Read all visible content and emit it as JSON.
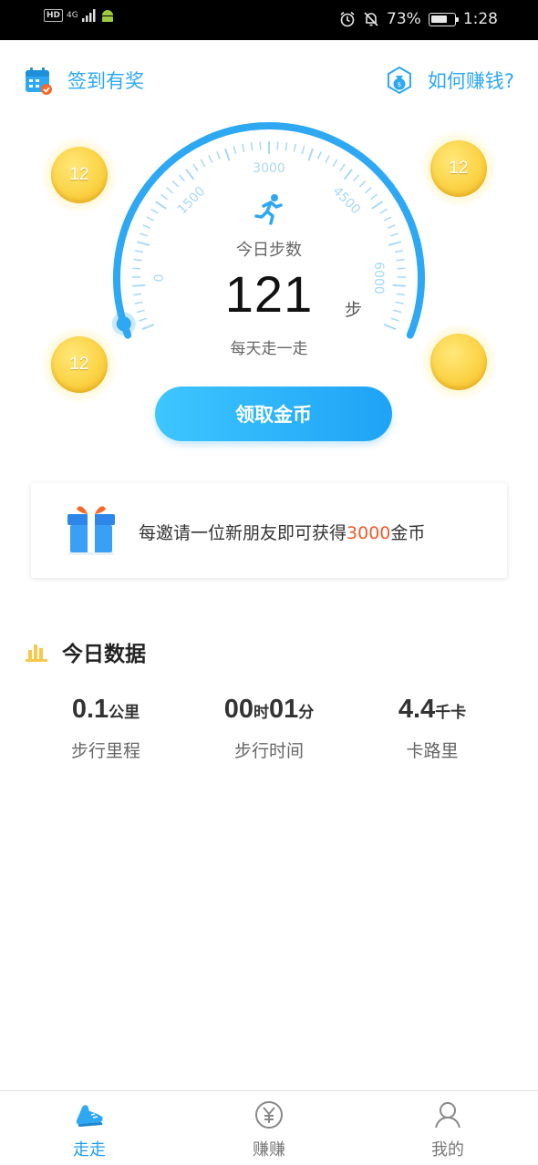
{
  "status_bar": {
    "hd": "HD",
    "network": "4G",
    "battery_percent": "73%",
    "battery_level": 0.73,
    "time": "1:28",
    "icons": [
      "alarm-icon",
      "mute-icon",
      "battery-icon"
    ]
  },
  "header": {
    "signin_label": "签到有奖",
    "how_to_earn_label": "如何赚钱?"
  },
  "gauge": {
    "ticks": [
      "0",
      "1500",
      "3000",
      "4500",
      "6000"
    ],
    "today_steps_label": "今日步数",
    "step_count": "121",
    "step_unit": "步",
    "slogan": "每天走一走",
    "progress": 0.02
  },
  "coins": [
    "12",
    "12",
    "12",
    ""
  ],
  "claim_button": "领取金币",
  "invite": {
    "text_prefix": "每邀请一位新朋友即可获得",
    "amount": "3000",
    "text_suffix": "金币"
  },
  "today_data": {
    "title": "今日数据",
    "stats": [
      {
        "value_parts": [
          "0.1",
          "公里"
        ],
        "label": "步行里程"
      },
      {
        "value_parts": [
          "00",
          "时",
          "01",
          "分"
        ],
        "label": "步行时间"
      },
      {
        "value_parts": [
          "4.4",
          "千卡"
        ],
        "label": "卡路里"
      }
    ]
  },
  "bottom_nav": {
    "items": [
      {
        "label": "走走",
        "icon": "shoe-icon",
        "active": true
      },
      {
        "label": "赚赚",
        "icon": "yuan-icon",
        "active": false
      },
      {
        "label": "我的",
        "icon": "user-icon",
        "active": false
      }
    ]
  },
  "colors": {
    "accent": "#2ea8f2",
    "highlight": "#f05a28",
    "coin": "#fbd346"
  }
}
